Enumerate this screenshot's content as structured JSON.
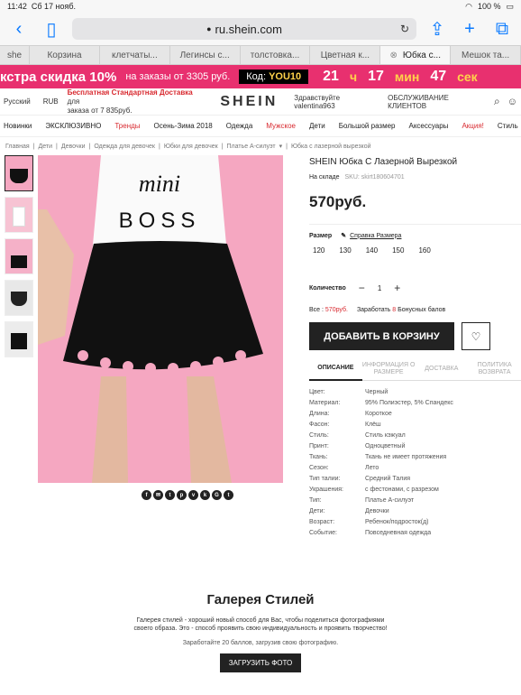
{
  "status": {
    "time": "11:42",
    "date": "Сб 17 нояб.",
    "battery": "100 %"
  },
  "browser": {
    "url": "ru.shein.com"
  },
  "tabs": [
    {
      "label": "she"
    },
    {
      "label": "Корзина"
    },
    {
      "label": "клетчаты..."
    },
    {
      "label": "Легинсы с..."
    },
    {
      "label": "толстовка..."
    },
    {
      "label": "Цветная к..."
    },
    {
      "label": "Юбка с...",
      "active": true
    },
    {
      "label": "Мешок та..."
    }
  ],
  "promo": {
    "headline": "кстра скидка 10%",
    "condition": "на заказы от 3305 руб.",
    "code_label": "Код:",
    "code": "YOU10",
    "timer": {
      "hours": "21",
      "hours_unit": "ч",
      "minutes": "17",
      "minutes_unit": "мин",
      "seconds": "47",
      "seconds_unit": "сек"
    }
  },
  "topnav": {
    "language": "Русский",
    "currency": "RUB",
    "shipping_title": "Бесплатная Стандартная Доставка",
    "shipping_suffix": "для",
    "shipping_line2": "заказа от 7 835руб.",
    "logo": "SHEIN",
    "greeting": "Здравствуйте valentina963",
    "service": "ОБСЛУЖИВАНИЕ КЛИЕНТОВ"
  },
  "categories": [
    "Новинки",
    "ЭКСКЛЮЗИВНО",
    "Тренды",
    "Осень-Зима 2018",
    "Одежда",
    "Мужское",
    "Дети",
    "Большой размер",
    "Аксессуары",
    "Акция!",
    "Стиль"
  ],
  "breadcrumbs": [
    "Главная",
    "Дети",
    "Девочки",
    "Одежда для девочек",
    "Юбки для девочек",
    "Платье А-силуэт",
    "Юбка с лазерной вырезкой"
  ],
  "product": {
    "title": "SHEIN Юбка С Лазерной Вырезкой",
    "stock": "На складе",
    "sku": "SKU: skirt180604701",
    "price": "570руб.",
    "size_label": "Размер",
    "size_guide": "Справка Размера",
    "sizes": [
      "120",
      "130",
      "140",
      "150",
      "160"
    ],
    "qty_label": "Количество",
    "qty_value": "1",
    "total_label": "Все :",
    "total_value": "570руб.",
    "earn_label": "Заработать",
    "earn_value": "8",
    "bonus_label": "Бонусных балов",
    "add_to_cart": "ДОБАВИТЬ В КОРЗИНУ",
    "tee_line1": "mini",
    "tee_line2": "BOSS"
  },
  "detail_tabs": [
    "ОПИСАНИЕ",
    "ИНФОРМАЦИЯ О РАЗМЕРЕ",
    "ДОСТАВКА",
    "ПОЛИТИКА ВОЗВРАТА"
  ],
  "attributes": [
    {
      "k": "Цвет:",
      "v": "Черный"
    },
    {
      "k": "Материал:",
      "v": "95% Полиэстер, 5% Спандекс"
    },
    {
      "k": "Длина:",
      "v": "Короткое"
    },
    {
      "k": "Фасон:",
      "v": "Клёш"
    },
    {
      "k": "Стиль:",
      "v": "Стиль кэжуал"
    },
    {
      "k": "Принт:",
      "v": "Одноцветный"
    },
    {
      "k": "Ткань:",
      "v": "Ткань не имеет протяжения"
    },
    {
      "k": "Сезон:",
      "v": "Лето"
    },
    {
      "k": "Тип талии:",
      "v": "Средний Талия"
    },
    {
      "k": "Украшения:",
      "v": "с фестонами, с разрезом"
    },
    {
      "k": "Тип:",
      "v": "Платье А-силуэт"
    },
    {
      "k": "Дети:",
      "v": "Девочки"
    },
    {
      "k": "Возраст:",
      "v": "Ребенок/подросток(д)"
    },
    {
      "k": "Событие:",
      "v": "Повседневная одежда"
    }
  ],
  "share_icons": [
    "f",
    "✉",
    "t",
    "p",
    "v",
    "k",
    "G",
    "t"
  ],
  "gallery": {
    "title": "Галерея Стилей",
    "desc1": "Галерея стилей - хороший новый способ для Вас, чтобы поделиться фотографиями",
    "desc2": "своего образа. Это - способ проявить свою индивидуальность и проявить творчество!",
    "earn": "Заработайте 20 баллов, загрузив свою фотографию.",
    "upload": "ЗАГРУЗИТЬ ФОТО"
  },
  "colors": {
    "accent": "#e8306f",
    "sale": "#d8292f",
    "dark": "#222222",
    "product_bg": "#f5a7c1"
  }
}
